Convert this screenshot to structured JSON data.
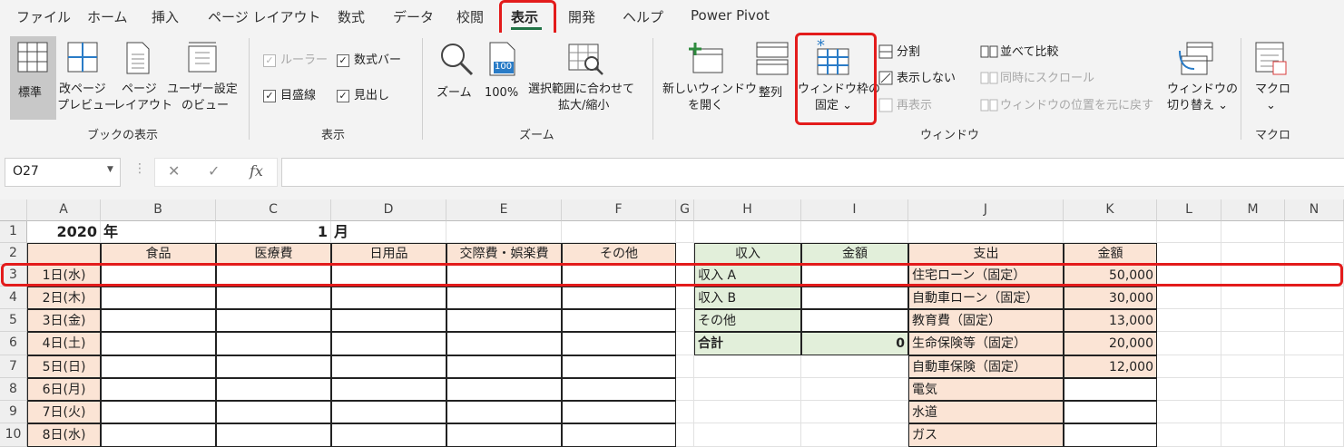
{
  "tabs": [
    "ファイル",
    "ホーム",
    "挿入",
    "ページ レイアウト",
    "数式",
    "データ",
    "校閲",
    "表示",
    "開発",
    "ヘルプ",
    "Power Pivot"
  ],
  "active_tab": "表示",
  "ribbon": {
    "book_view": {
      "group": "ブックの表示",
      "normal": "標準",
      "page_break": [
        "改ページ",
        "プレビュー"
      ],
      "page_layout": [
        "ページ",
        "レイアウト"
      ],
      "custom": [
        "ユーザー設定",
        "のビュー"
      ]
    },
    "show": {
      "group": "表示",
      "ruler": "ルーラー",
      "formula_bar": "数式バー",
      "gridlines": "目盛線",
      "headings": "見出し"
    },
    "zoom": {
      "group": "ズーム",
      "zoom": "ズーム",
      "hundred": "100%",
      "icon_100": "100",
      "selection": [
        "選択範囲に合わせて",
        "拡大/縮小"
      ]
    },
    "window": {
      "group": "ウィンドウ",
      "new_window": [
        "新しいウィンドウ",
        "を開く"
      ],
      "arrange": "整列",
      "freeze": [
        "ウィンドウ枠の",
        "固定 ⌄"
      ],
      "split": "分割",
      "hide": "表示しない",
      "unhide": "再表示",
      "side_by_side": "並べて比較",
      "sync_scroll": "同時にスクロール",
      "reset_pos": "ウィンドウの位置を元に戻す",
      "switch": [
        "ウィンドウの",
        "切り替え ⌄"
      ]
    },
    "macro": {
      "group": "マクロ",
      "macro": "マクロ",
      "chevron": "⌄"
    }
  },
  "formula_bar": {
    "name_box": "O27",
    "cancel": "✕",
    "enter": "✓",
    "fx": "fx",
    "value": ""
  },
  "columns": [
    "A",
    "B",
    "C",
    "D",
    "E",
    "F",
    "G",
    "H",
    "I",
    "J",
    "K",
    "L",
    "M",
    "N"
  ],
  "rows": [
    "1",
    "2",
    "3",
    "4",
    "5",
    "6",
    "7",
    "8",
    "9",
    "10"
  ],
  "sheet": {
    "r1": {
      "a": "2020",
      "b": "年",
      "c": "1",
      "d": "月"
    },
    "headers": [
      "食品",
      "医療費",
      "日用品",
      "交際費・娯楽費",
      "その他"
    ],
    "dates": [
      "1日(水)",
      "2日(木)",
      "3日(金)",
      "4日(土)",
      "5日(日)",
      "6日(月)",
      "7日(火)",
      "8日(水)"
    ],
    "income": {
      "h_header": "収入",
      "i_header": "金額",
      "rows": [
        "収入 A",
        "収入 B",
        "その他"
      ],
      "total_label": "合計",
      "total_value": "0"
    },
    "expense": {
      "j_header": "支出",
      "k_header": "金額",
      "rows": [
        {
          "label": "住宅ローン（固定）",
          "value": "50,000"
        },
        {
          "label": "自動車ローン（固定）",
          "value": "30,000"
        },
        {
          "label": "教育費（固定）",
          "value": "13,000"
        },
        {
          "label": "生命保険等（固定）",
          "value": "20,000"
        },
        {
          "label": "自動車保険（固定）",
          "value": "12,000"
        },
        {
          "label": "電気",
          "value": ""
        },
        {
          "label": "水道",
          "value": ""
        },
        {
          "label": "ガス",
          "value": ""
        }
      ]
    }
  },
  "colors": {
    "accent": "#217346",
    "highlight": "#e31b1b",
    "pink": "#fbe4d5",
    "green": "#e2efda"
  }
}
